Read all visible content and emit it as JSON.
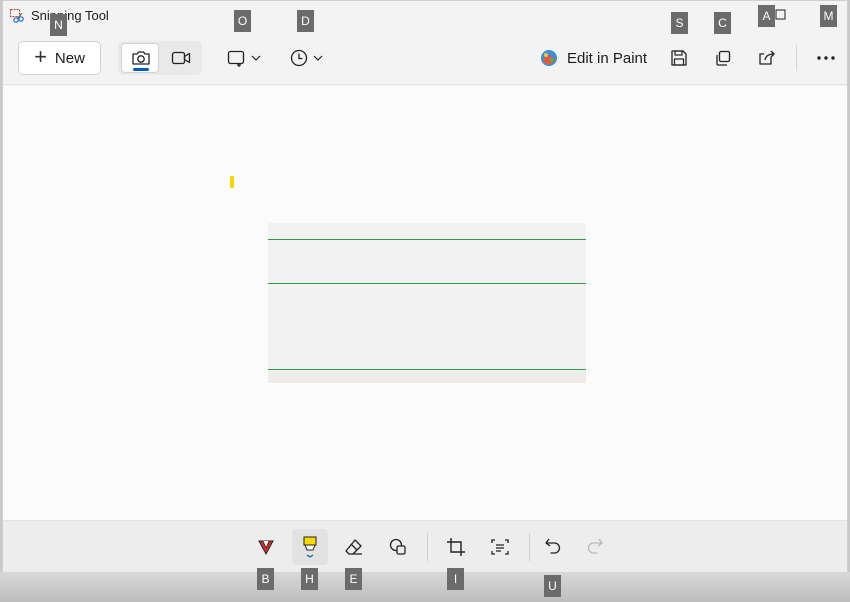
{
  "app": {
    "title": "Snipping Tool",
    "accent_color": "#005fb8"
  },
  "toolbar": {
    "new_label": "New",
    "edit_in_paint_label": "Edit in Paint",
    "icons": [
      "plus-icon",
      "camera-icon",
      "video-icon",
      "snip-mode-icon",
      "chevron-down-icon",
      "timer-icon",
      "paint-icon",
      "save-icon",
      "copy-icon",
      "share-icon",
      "more-icon"
    ]
  },
  "bottombar": {
    "icons": [
      "ballpoint-pen-icon",
      "highlighter-icon",
      "eraser-icon",
      "shapes-icon",
      "crop-icon",
      "text-actions-icon",
      "undo-icon",
      "redo-icon"
    ],
    "highlighter_color": "#f5d900",
    "pen_color": "#d32f2f"
  },
  "canvas": {
    "line_color": "#2e9c4a"
  },
  "key_hints": {
    "new": "N",
    "snip_mode": "O",
    "delay": "D",
    "save": "S",
    "copy": "C",
    "maximize": "A",
    "more": "M",
    "pen": "B",
    "highlighter": "H",
    "eraser": "E",
    "crop": "I",
    "undo": "U"
  }
}
